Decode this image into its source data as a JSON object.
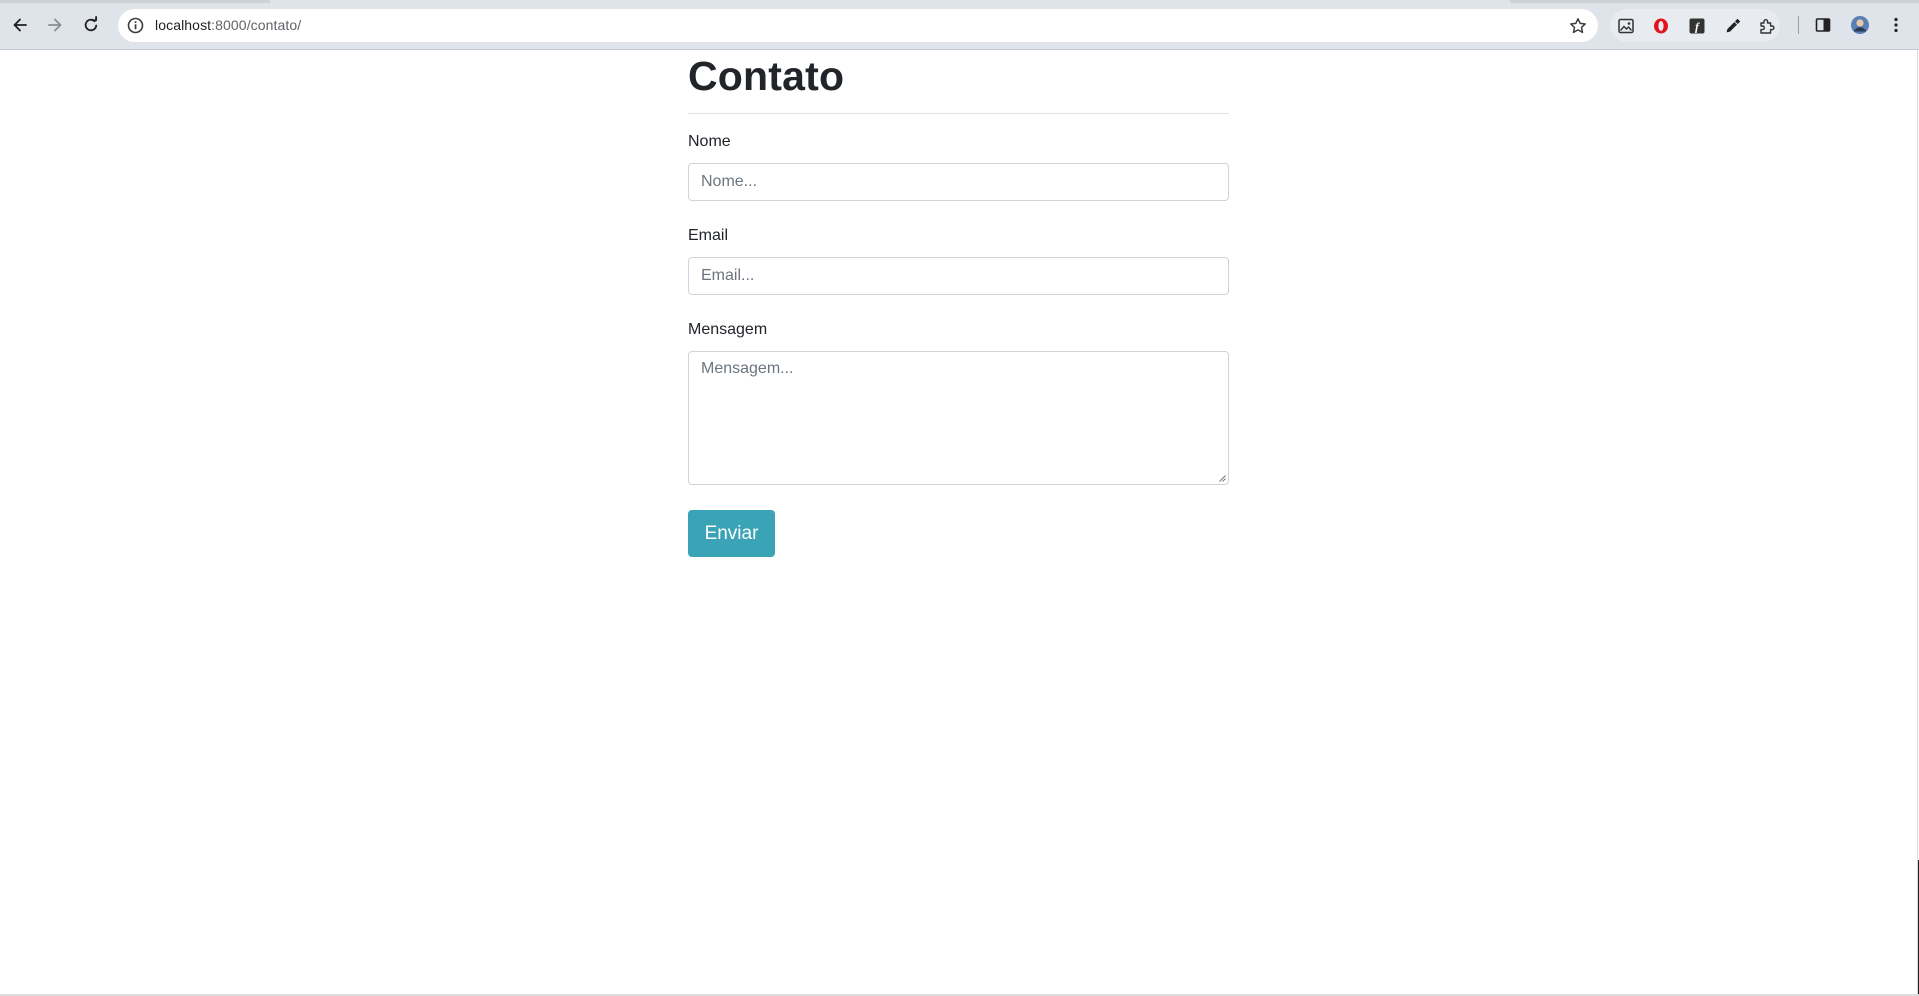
{
  "browser": {
    "url_host": "localhost",
    "url_rest": ":8000/contato/",
    "icons": {
      "back": "arrow-left-icon",
      "forward": "arrow-right-icon",
      "reload": "reload-icon",
      "site_info": "info-circle-icon",
      "bookmark": "star-icon",
      "menu": "kebab-menu-icon"
    }
  },
  "page": {
    "title": "Contato",
    "form": {
      "name_label": "Nome",
      "name_placeholder": "Nome...",
      "email_label": "Email",
      "email_placeholder": "Email...",
      "message_label": "Mensagem",
      "message_placeholder": "Mensagem...",
      "submit_label": "Enviar"
    }
  },
  "colors": {
    "button": "#3aa3b6",
    "text": "#212529",
    "placeholder": "#6c757d",
    "border": "#ced4da"
  }
}
